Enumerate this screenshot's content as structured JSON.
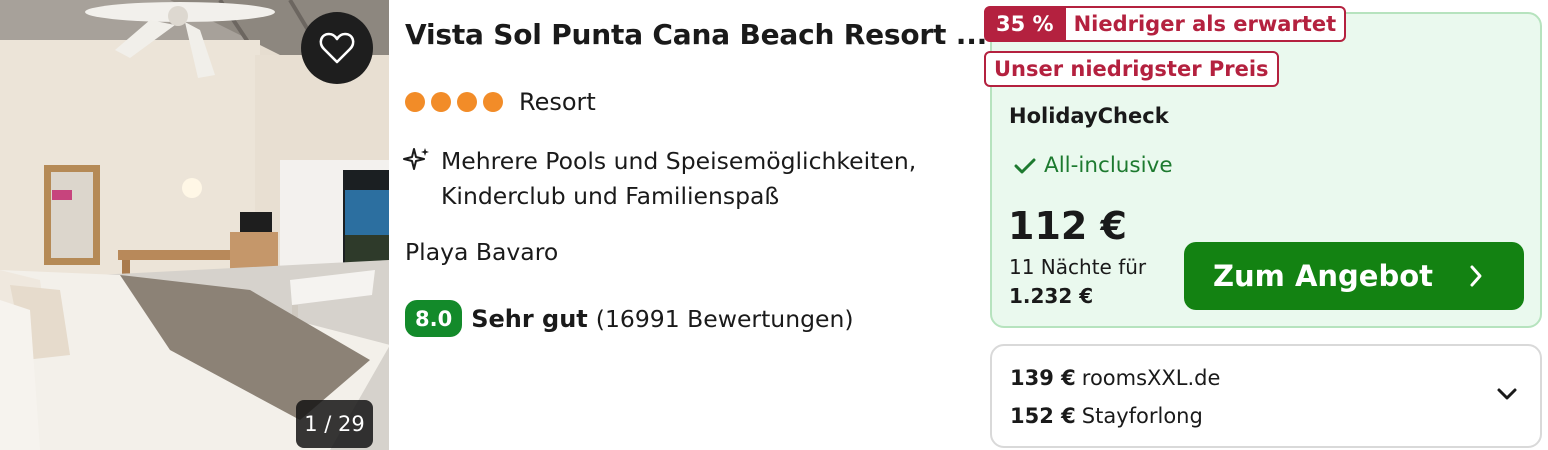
{
  "hotel": {
    "title": "Vista Sol Punta Cana Beach Resort ...",
    "rating_dots": 4,
    "type": "Resort",
    "highlight": "Mehrere Pools und Speisemöglichkeiten, Kinderclub und Familienspaß",
    "location": "Playa Bavaro",
    "score": "8.0",
    "score_label": "Sehr gut",
    "review_count": "(16991 Bewertungen)"
  },
  "photo": {
    "counter": "1 / 29",
    "favorite_icon": "heart-outline-icon"
  },
  "deal": {
    "discount": "35 %",
    "discount_label": "Niedriger als erwartet",
    "lowest_price_label": "Unser niedrigster Preis",
    "provider": "HolidayCheck",
    "board": "All-inclusive",
    "price": "112 €",
    "nights": "11 Nächte für",
    "total": "1.232 €",
    "cta": "Zum Angebot"
  },
  "alternatives": [
    {
      "price": "139 €",
      "provider": "roomsXXL.de"
    },
    {
      "price": "152 €",
      "provider": "Stayforlong"
    }
  ],
  "colors": {
    "accent_green": "#138212",
    "deal_red": "#b4213f",
    "rating_orange": "#f28c28",
    "offer_bg": "#eaf9ee"
  }
}
